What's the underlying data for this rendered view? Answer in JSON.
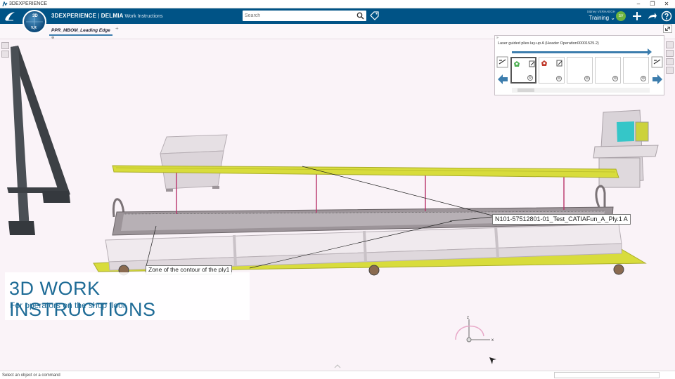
{
  "os_bar": {
    "title": "3DEXPERIENCE",
    "minimize": "–",
    "maximize": "❐",
    "close": "✕"
  },
  "header": {
    "brand_main": "3DEXPERIENCE",
    "brand_separator": " | ",
    "brand_product": "DELMIA",
    "brand_app": " Work Instructions",
    "compass_version": "V.R",
    "compass_top": "3D",
    "search": {
      "placeholder": "Search",
      "value": ""
    },
    "user_name": "Sidney VERHAEGH",
    "collab_space": "Training ⌄",
    "avatar_initials": "SV",
    "accent_color": "#005386"
  },
  "tabs": {
    "items": [
      {
        "label": "PPR_MBOM_Leading Edge"
      }
    ],
    "add_label": "+",
    "pin_label": "⊕"
  },
  "instructions_panel": {
    "pin_label": "»",
    "title": "Laser guided plies lay-up   A (Header Operation00001525.2)",
    "slot_badge": "⚙"
  },
  "viewport": {
    "callouts": {
      "ply": "N101-57512801-01_Test_CATIAFun_A_Ply.1 A",
      "zone": "Zone of the contour of the ply1"
    },
    "axis_labels": {
      "z": "z",
      "x": "x"
    }
  },
  "overlay": {
    "title": "3D WORK INSTRUCTIONS",
    "subtitle": "For operators on the shop floor"
  },
  "status_bar": {
    "prompt": "Select an object or a command",
    "command_input": ""
  },
  "colors": {
    "ply_yellow": "#d8dc3c",
    "table_frame": "#e8e2e6",
    "stand_dark": "#3c4045",
    "link_line": "#b8326a",
    "console_screen": "#35c6c8"
  }
}
